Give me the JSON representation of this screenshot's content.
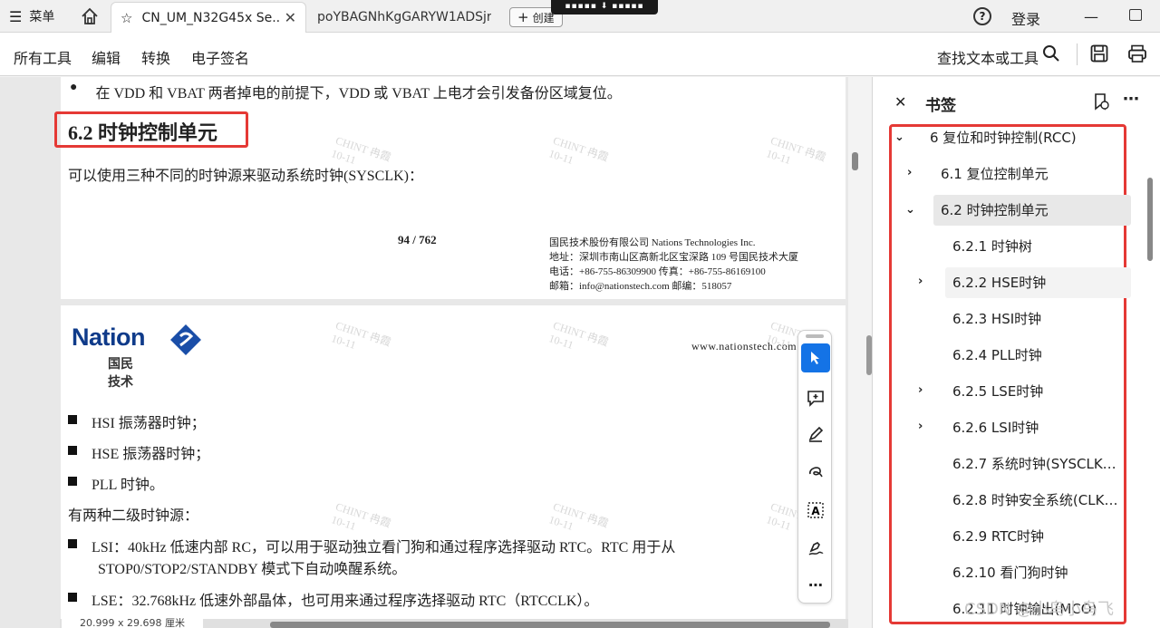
{
  "tabbar": {
    "menu_label": "菜单",
    "active_tab": "CN_UM_N32G45x Se...",
    "inactive_tab": "poYBAGNhKgGARYW1ADSjr...",
    "new_tab_label": "创建",
    "login_label": "登录"
  },
  "toolbar": {
    "items": [
      "所有工具",
      "编辑",
      "转换",
      "电子签名"
    ],
    "find_label": "查找文本或工具"
  },
  "page1": {
    "bullet_text": "在 VDD 和 VBAT 两者掉电的前提下，VDD 或 VBAT 上电才会引发备份区域复位。",
    "heading": "6.2 时钟控制单元",
    "body": "可以使用三种不同的时钟源来驱动系统时钟(SYSCLK)：",
    "page_number": "94 / 762",
    "footer_lines": [
      "国民技术股份有限公司  Nations Technologies Inc.",
      "地址：深圳市南山区高新北区宝深路 109 号国民技术大厦",
      "电话：+86-755-86309900  传真：+86-755-86169100",
      "邮箱：info@nationstech.com  邮编：518057"
    ]
  },
  "watermark": {
    "line1": "CHINT 冉霞",
    "line2": "10-11"
  },
  "page2": {
    "logo_name": "Nation",
    "logo_cn": "国民技术",
    "website": "www.nationstech.com",
    "list1": [
      "HSI 振荡器时钟；",
      "HSE 振荡器时钟；",
      "PLL 时钟。"
    ],
    "secondary_intro": "有两种二级时钟源：",
    "lsi_line1": "LSI：40kHz  低速内部  RC，可以用于驱动独立看门狗和通过程序选择驱动  RTC。RTC  用于从",
    "lsi_line2": "STOP0/STOP2/STANDBY 模式下自动唤醒系统。",
    "lse_line": "LSE：32.768kHz 低速外部晶体，也可用来通过程序选择驱动 RTC（RTCCLK）。"
  },
  "statusbar": {
    "page_size": "20.999 x 29.698 厘米"
  },
  "bookmarks": {
    "title": "书签",
    "items": [
      {
        "label": "6 复位和时钟控制(RCC)",
        "expanded": true,
        "level": 0
      },
      {
        "label": "6.1 复位控制单元",
        "expanded": false,
        "level": 1
      },
      {
        "label": "6.2 时钟控制单元",
        "expanded": true,
        "level": 1,
        "selected": true
      },
      {
        "label": "6.2.1 时钟树",
        "level": 2
      },
      {
        "label": "6.2.2 HSE时钟",
        "expanded": false,
        "level": 2
      },
      {
        "label": "6.2.3 HSI时钟",
        "level": 2
      },
      {
        "label": "6.2.4 PLL时钟",
        "level": 2
      },
      {
        "label": "6.2.5 LSE时钟",
        "expanded": false,
        "level": 2
      },
      {
        "label": "6.2.6 LSI时钟",
        "expanded": false,
        "level": 2
      },
      {
        "label": "6.2.7 系统时钟(SYSCLK)...",
        "level": 2
      },
      {
        "label": "6.2.8 时钟安全系统(CLKS...",
        "level": 2
      },
      {
        "label": "6.2.9 RTC时钟",
        "level": 2
      },
      {
        "label": "6.2.10 看门狗时钟",
        "level": 2
      },
      {
        "label": "6.2.11 时钟输出(MCO)",
        "level": 2
      }
    ]
  },
  "credit": "CSDN @小鸟小鸟飞",
  "colors": {
    "accent": "#1473e6",
    "highlight_box": "#e53935"
  }
}
